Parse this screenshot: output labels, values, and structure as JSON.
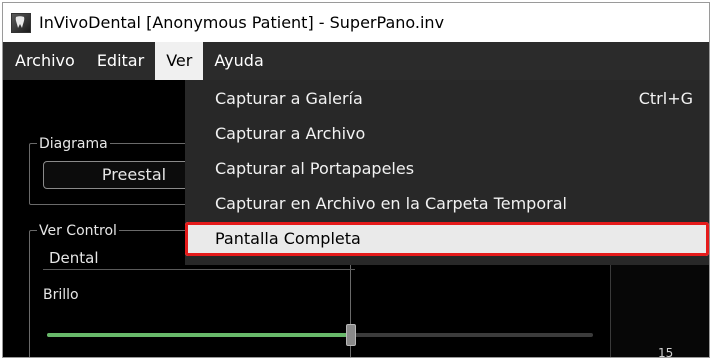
{
  "window": {
    "title": "InVivoDental [Anonymous Patient] - SuperPano.inv",
    "icon": "app-logo-icon"
  },
  "menubar": {
    "items": [
      {
        "label": "Archivo"
      },
      {
        "label": "Editar"
      },
      {
        "label": "Ver",
        "active": true
      },
      {
        "label": "Ayuda"
      }
    ]
  },
  "left_panel": {
    "diagram_group_label": "Diagrama",
    "preset_button_label": "Preestal",
    "ver_control_group_label": "Ver Control",
    "dental_value": "Dental",
    "brillo_label": "Brillo",
    "brillo_level_fraction": 0.5
  },
  "right_panel": {
    "ruler_label": "15"
  },
  "dropdown": {
    "items": [
      {
        "label": "Capturar a Galería",
        "shortcut": "Ctrl+G"
      },
      {
        "label": "Capturar a Archivo",
        "shortcut": ""
      },
      {
        "label": "Capturar al Portapapeles",
        "shortcut": ""
      },
      {
        "label": "Capturar en Archivo en la Carpeta Temporal",
        "shortcut": ""
      },
      {
        "label": "Pantalla Completa",
        "shortcut": "",
        "highlighted": true
      }
    ]
  },
  "colors": {
    "highlight_outline": "#e51b1b",
    "slider_fill": "#68b86a",
    "menubar_bg": "#2b2b2b"
  }
}
